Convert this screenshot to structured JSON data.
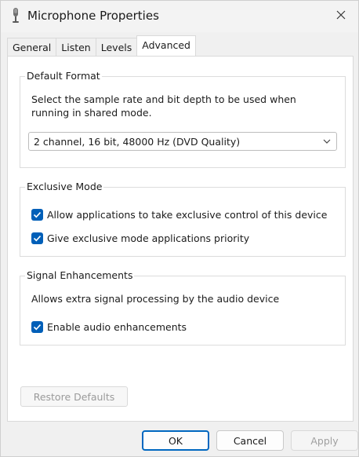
{
  "window": {
    "title": "Microphone Properties",
    "icon": "microphone-icon",
    "close_icon": "close-icon"
  },
  "tabs": [
    {
      "label": "General",
      "active": false
    },
    {
      "label": "Listen",
      "active": false
    },
    {
      "label": "Levels",
      "active": false
    },
    {
      "label": "Advanced",
      "active": true
    }
  ],
  "default_format": {
    "legend": "Default Format",
    "description": "Select the sample rate and bit depth to be used when running in shared mode.",
    "selected": "2 channel, 16 bit, 48000 Hz (DVD Quality)"
  },
  "exclusive_mode": {
    "legend": "Exclusive Mode",
    "options": [
      {
        "label": "Allow applications to take exclusive control of this device",
        "checked": true
      },
      {
        "label": "Give exclusive mode applications priority",
        "checked": true
      }
    ]
  },
  "signal_enhancements": {
    "legend": "Signal Enhancements",
    "description": "Allows extra signal processing by the audio device",
    "option": {
      "label": "Enable audio enhancements",
      "checked": true
    }
  },
  "restore_defaults_label": "Restore Defaults",
  "footer": {
    "ok_label": "OK",
    "cancel_label": "Cancel",
    "apply_label": "Apply"
  },
  "colors": {
    "accent": "#005fb8",
    "window_bg": "#f0f0f0",
    "panel_bg": "#ffffff"
  }
}
